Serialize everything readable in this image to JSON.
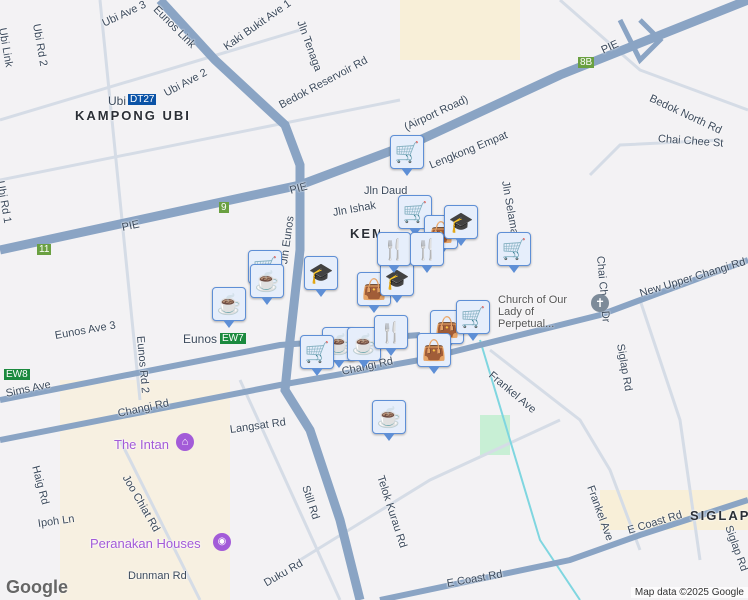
{
  "map": {
    "areas": [
      "KAMPONG UBI",
      "KEMBANGAN",
      "SIGLAP"
    ],
    "roads": [
      "Ubi Link",
      "Ubi Rd 2",
      "Ubi Ave 3",
      "Eunos Link",
      "Kaki Bukit Ave 1",
      "Jln Tenaga",
      "Bedok Reservoir Rd",
      "Ubi Ave 2",
      "PIE",
      "PIE",
      "PIE",
      "Ubi Rd 1",
      "Jln Eunos",
      "Jln Ishak",
      "Jln Daud",
      "Lengkong Empat",
      "Jln Selamat",
      "Bedok North Rd",
      "Chai Chee St",
      "Chai Chee Dr",
      "New Upper Changi Rd",
      "Siglap Rd",
      "Eunos Ave 3",
      "Eunos Rd 2",
      "Sims Ave",
      "Changi Rd",
      "Changi Rd",
      "Langsat Rd",
      "Haig Rd",
      "Joo Chiat Rd",
      "Telok Kurau Rd",
      "Frankel Ave",
      "Frankel Ave",
      "Ipoh Ln",
      "Dunman Rd",
      "Duku Rd",
      "E Coast Rd",
      "E Coast Rd",
      "Still Rd",
      "Siglap Rd",
      "(Airport Road)"
    ],
    "stations": [
      {
        "name": "Ubi",
        "code": "DT27",
        "color": "#0a52a6"
      },
      {
        "name": "Eunos",
        "code": "EW7",
        "color": "#1b8a3e"
      },
      {
        "name": "",
        "code": "EW8",
        "color": "#1b8a3e"
      }
    ],
    "exits": [
      "11",
      "9",
      "8B"
    ],
    "pois": [
      "The Intan",
      "Peranakan Houses",
      "Church of Our Lady of Perpetual..."
    ],
    "markers": [
      "cart",
      "cart",
      "coffee",
      "coffee",
      "graduation-cap",
      "shopping-bag",
      "graduation-cap",
      "cart",
      "shopping-bag",
      "graduation-cap",
      "cart",
      "utensils",
      "utensils",
      "coffee",
      "coffee",
      "cart",
      "utensils",
      "shopping-bag",
      "cart",
      "shopping-bag",
      "coffee"
    ],
    "logo": "Google",
    "attribution": "Map data ©2025 Google"
  }
}
